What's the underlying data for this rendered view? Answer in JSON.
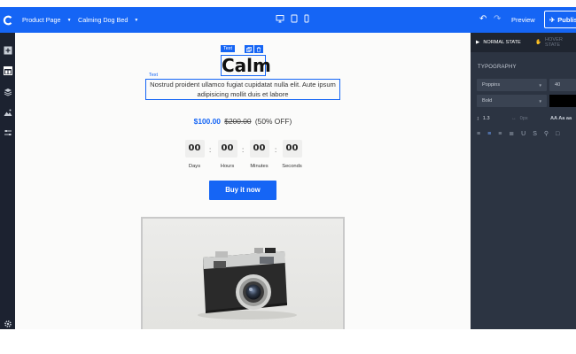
{
  "topbar": {
    "page_selector": "Product Page",
    "product_selector": "Calming Dog Bed",
    "preview_label": "Preview",
    "publish_label": "Publis"
  },
  "canvas": {
    "heading_tag": "Text",
    "heading": "Calm",
    "paragraph_tag": "Text",
    "paragraph": "Nostrud proident ullamco fugiat cupidatat nulla elit. Aute ipsum adipisicing mollit duis et labore",
    "price_now": "$100.00",
    "price_old": "$200.00",
    "price_off": "(50% OFF)",
    "countdown": [
      {
        "value": "00",
        "label": "Days"
      },
      {
        "value": "00",
        "label": "Hours"
      },
      {
        "value": "00",
        "label": "Minutes"
      },
      {
        "value": "00",
        "label": "Seconds"
      }
    ],
    "buy_label": "Buy it now"
  },
  "panel": {
    "tab_normal": "NORMAL STATE",
    "tab_hover": "HOVER STATE",
    "section_title": "TYPOGRAPHY",
    "font_family": "Poppins",
    "font_size": "40",
    "font_weight": "Bold",
    "line_height": "1.3",
    "letter_spacing": "0px",
    "case_options": "AA Aa aa"
  },
  "colors": {
    "accent": "#1565f5",
    "rail": "#1c2230",
    "panel": "#2c3442"
  }
}
